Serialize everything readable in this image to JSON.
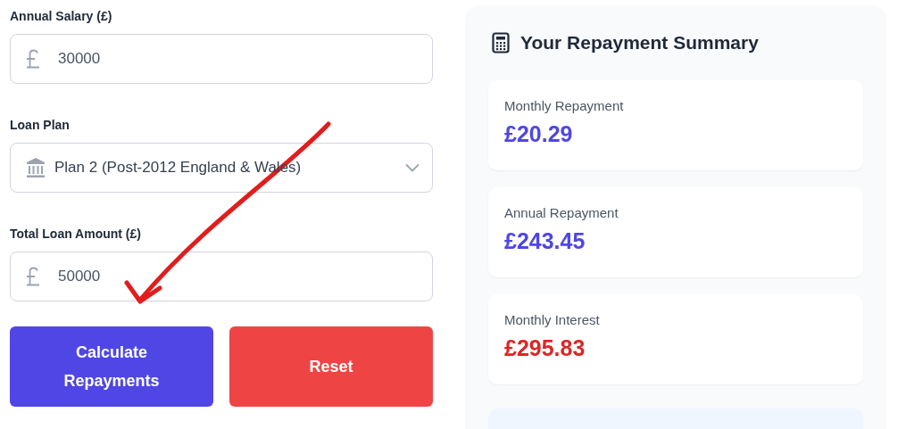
{
  "form": {
    "fields": [
      {
        "kind": "currency",
        "label": "Annual Salary (£)",
        "value": "30000"
      },
      {
        "kind": "select",
        "label": "Loan Plan",
        "value": "Plan 2 (Post-2012 England & Wales)"
      },
      {
        "kind": "currency",
        "label": "Total Loan Amount (£)",
        "value": "50000"
      }
    ],
    "buttons": [
      {
        "label": "Calculate Repayments",
        "kind": "primary"
      },
      {
        "label": "Reset",
        "kind": "danger"
      }
    ]
  },
  "summary": {
    "title": "Your Repayment Summary",
    "results": [
      {
        "label": "Monthly Repayment",
        "value": "£20.29",
        "color": "#4f46e5"
      },
      {
        "label": "Annual Repayment",
        "value": "£243.45",
        "color": "#4f46e5"
      },
      {
        "label": "Monthly Interest",
        "value": "£295.83",
        "color": "#dc2626"
      }
    ]
  }
}
